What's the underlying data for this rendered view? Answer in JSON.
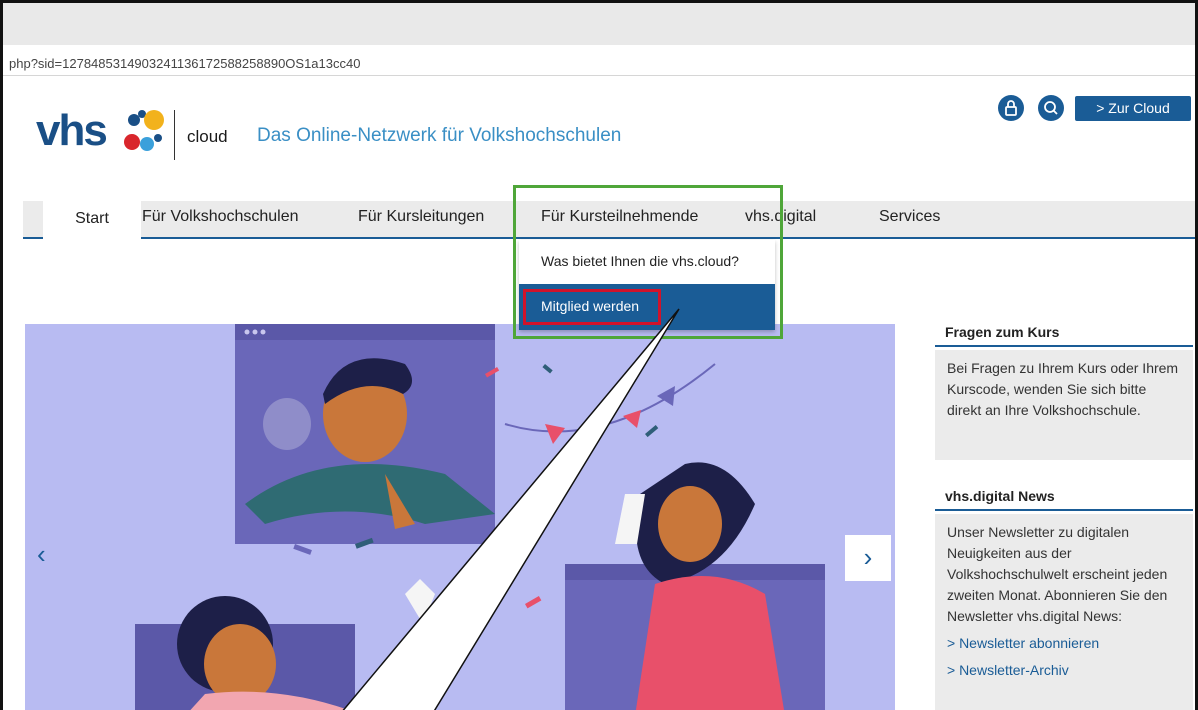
{
  "browser": {
    "url_fragment": "php?sid=1278485314903241136172588258890OS1a13cc40"
  },
  "header": {
    "logo_text": "vhs",
    "cloud_word": "cloud",
    "tagline": "Das Online-Netzwerk für Volkshochschulen",
    "zur_cloud_label": "> Zur Cloud",
    "lock_icon": "lock-icon",
    "search_icon": "search-icon"
  },
  "nav": {
    "items": [
      {
        "label": "Start"
      },
      {
        "label": "Für Volkshochschulen"
      },
      {
        "label": "Für Kursleitungen"
      },
      {
        "label": "Für Kursteilnehmende"
      },
      {
        "label": "vhs.digital"
      },
      {
        "label": "Services"
      }
    ]
  },
  "dropdown": {
    "items": [
      {
        "label": "Was bietet Ihnen die vhs.cloud?"
      },
      {
        "label": "Mitglied werden"
      }
    ]
  },
  "carousel": {
    "prev": "‹",
    "next": "›"
  },
  "sidebar": {
    "box1": {
      "title": "Fragen zum Kurs",
      "text": "Bei Fragen zu Ihrem Kurs oder Ihrem Kurscode, wenden Sie sich bitte direkt an Ihre Volkshochschule."
    },
    "box2": {
      "title": "vhs.digital News",
      "text": "Unser Newsletter zu digitalen Neuigkeiten aus der Volkshochschulwelt erscheint jeden zweiten Monat. Abonnieren Sie den Newsletter vhs.digital News:",
      "links": [
        "> Newsletter abonnieren",
        "> Newsletter-Archiv"
      ]
    }
  },
  "colors": {
    "brand_blue": "#1a5c96",
    "highlight_green": "#4fa639",
    "highlight_red": "#d1132b"
  }
}
